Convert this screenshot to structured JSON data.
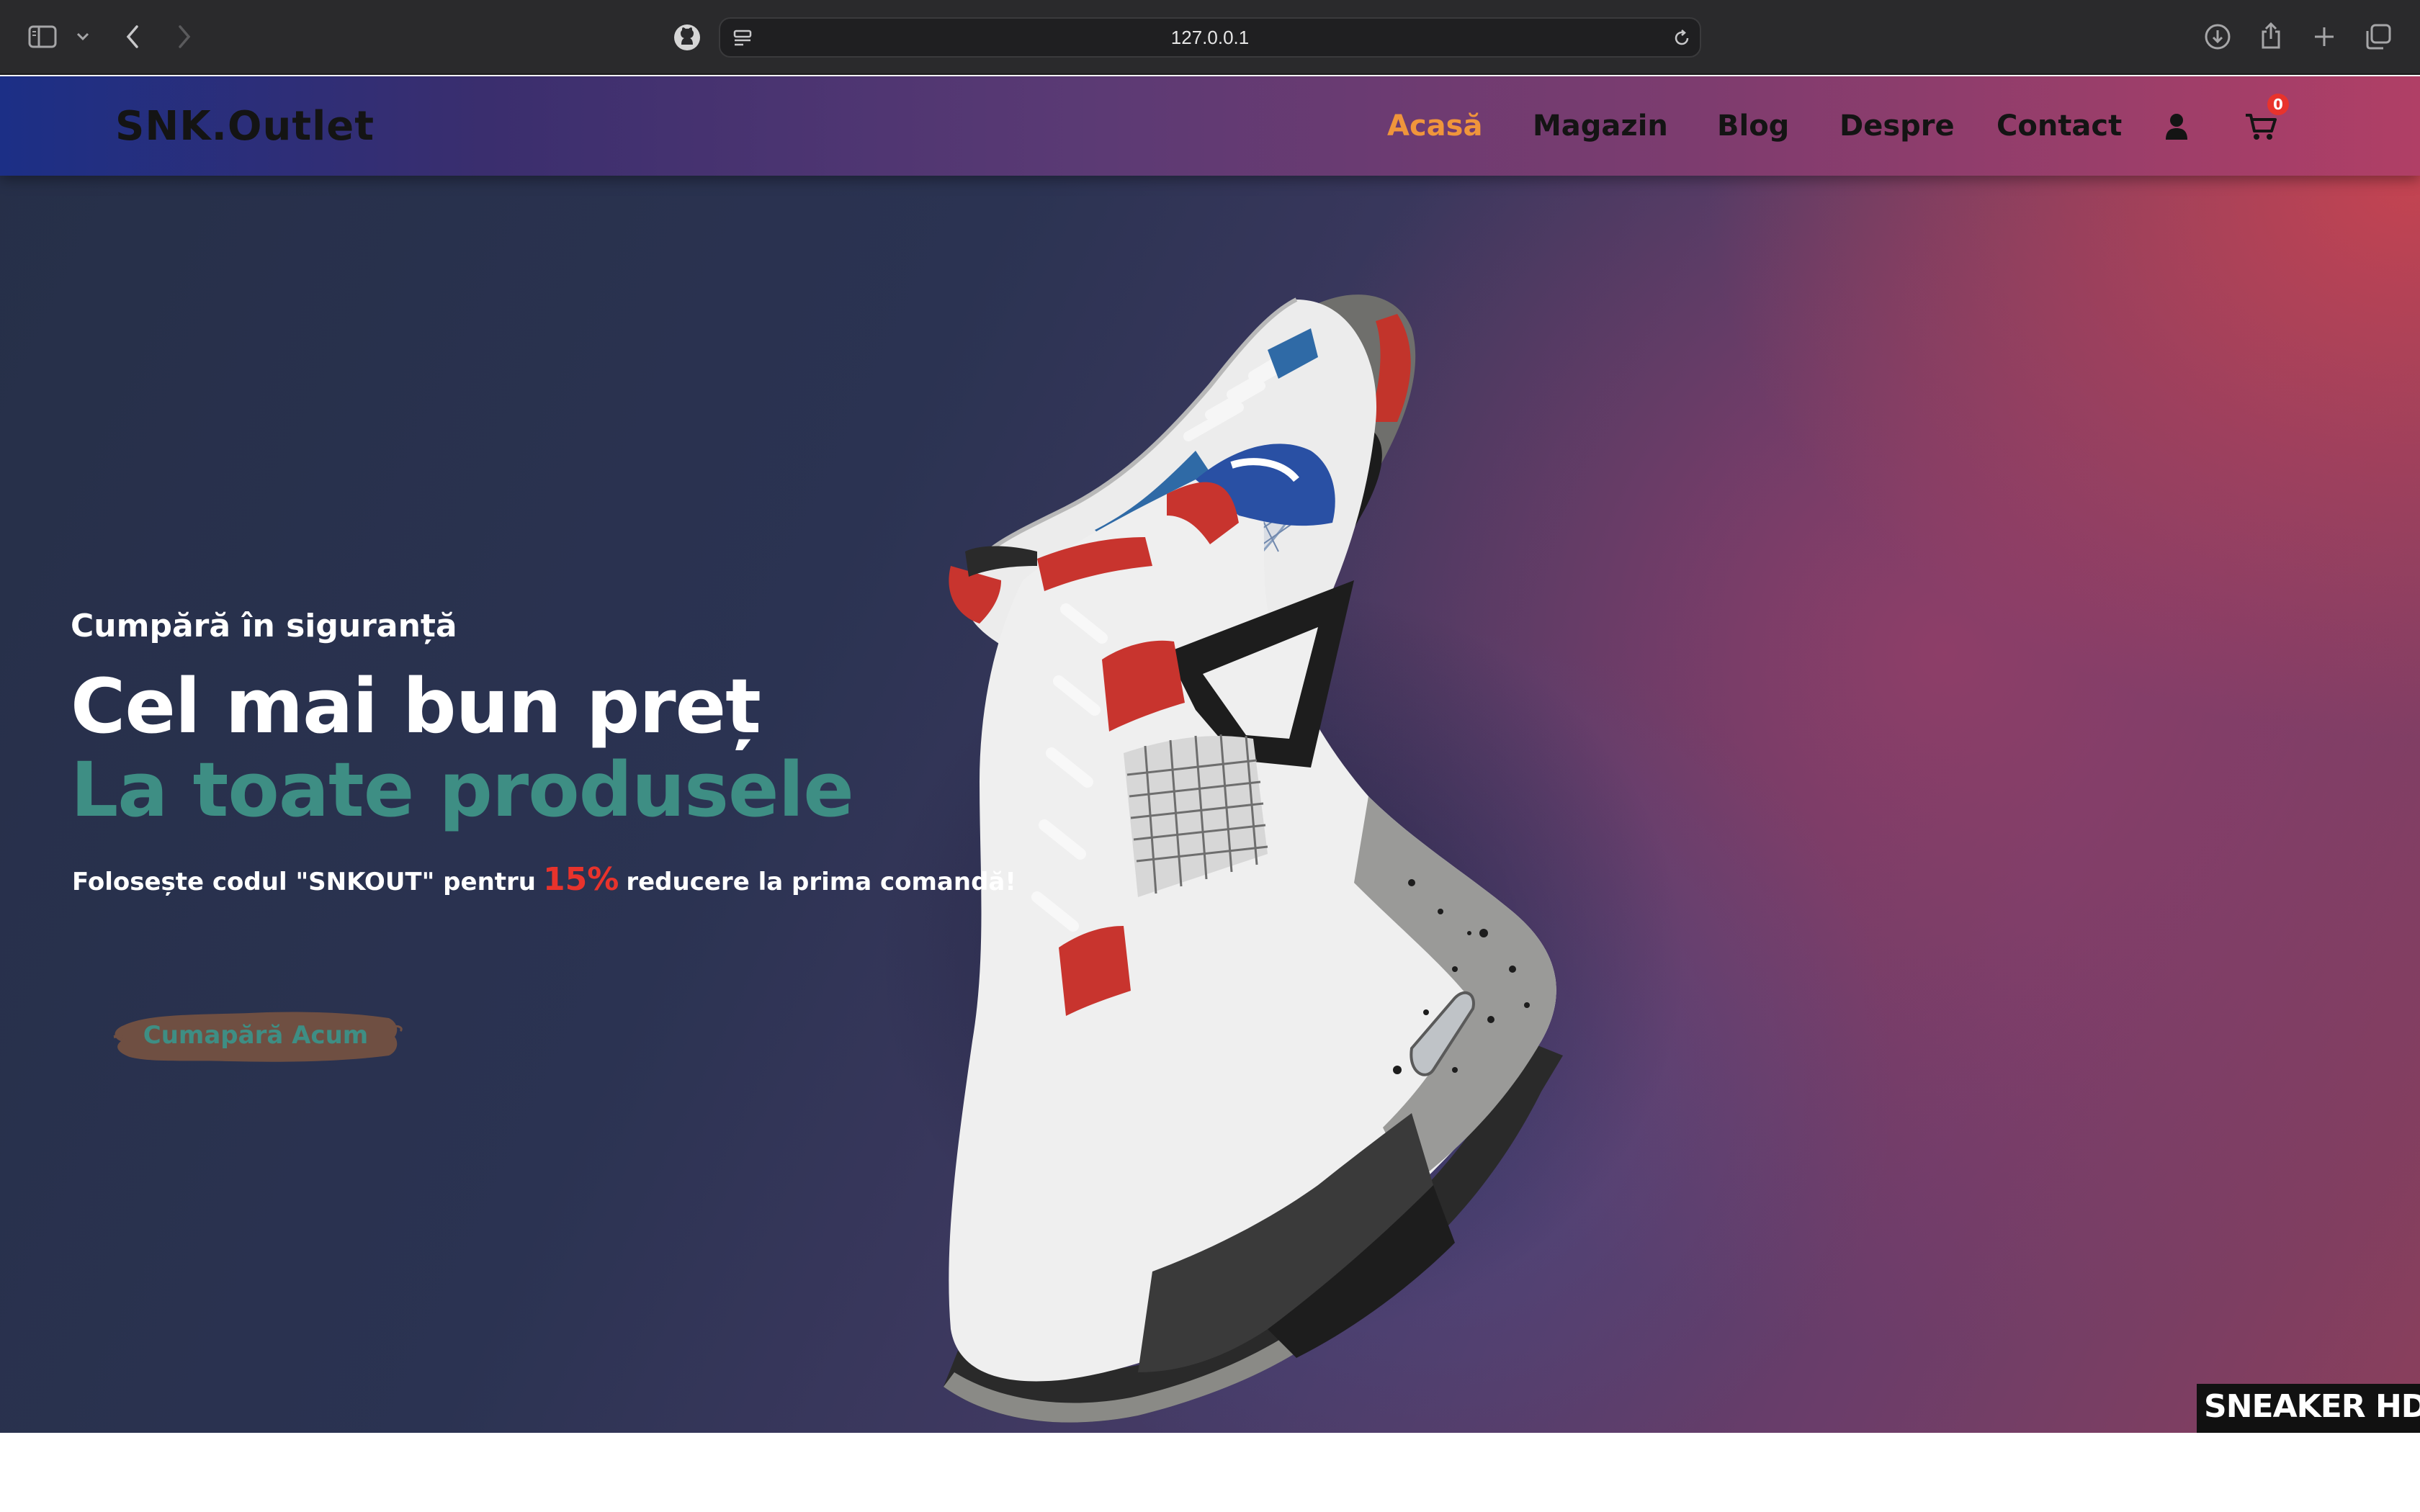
{
  "browser": {
    "url": "127.0.0.1",
    "icons": [
      "sidebar-icon",
      "chevron-down-icon",
      "back-icon",
      "forward-icon",
      "github-icon",
      "page-settings-icon",
      "reload-icon",
      "download-icon",
      "share-icon",
      "new-tab-icon",
      "tabs-overview-icon"
    ]
  },
  "nav": {
    "brand": "SNK.Outlet",
    "items": [
      {
        "label": "Acasă",
        "active": true
      },
      {
        "label": "Magazin"
      },
      {
        "label": "Blog"
      },
      {
        "label": "Despre"
      },
      {
        "label": "Contact"
      }
    ],
    "cart_count": "0",
    "icons": [
      "user-icon",
      "cart-icon"
    ]
  },
  "hero": {
    "kicker": "Cumpără în siguranță",
    "title": "Cel mai bun preț",
    "subtitle": "La toate produsele",
    "promo_before": "Folosește codul \"SNKOUT\" pentru",
    "promo_percent": "15%",
    "promo_after": "reducere la prima comandă!",
    "cta_label": "Cumapără Acum",
    "watermark": "SNEAKER HD WALLPAPERS.COM"
  },
  "colors": {
    "accent_active": "#f0953b",
    "accent_teal": "#3e8e84",
    "promo_red": "#e8332c"
  }
}
